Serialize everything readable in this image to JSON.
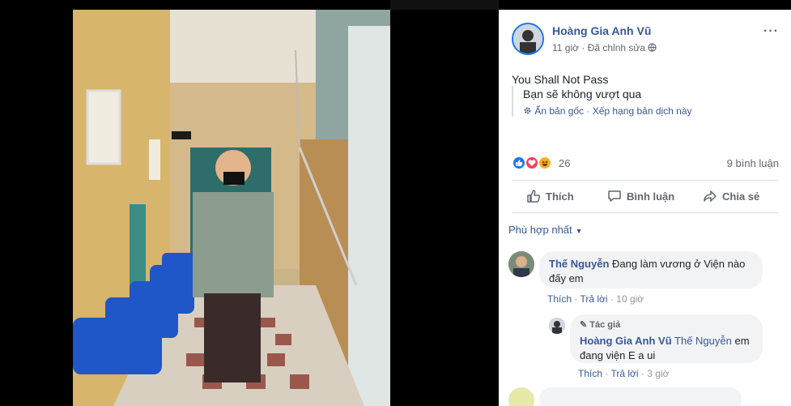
{
  "post": {
    "author": "Hoàng Gia Anh Vũ",
    "time": "11 giờ",
    "dot": "·",
    "edited": "Đã chỉnh sửa",
    "text": "You Shall Not Pass",
    "translation": "Bạn sẽ không vượt qua",
    "hide_original": "Ẩn bản gốc",
    "rate_translation": "Xếp hạng bản dịch này",
    "reaction_count": "26",
    "comment_count": "9 bình luận",
    "more": "···"
  },
  "actions": {
    "like": "Thích",
    "comment": "Bình luận",
    "share": "Chia sẻ"
  },
  "sort_label": "Phù hợp nhất",
  "comments": [
    {
      "name": "Thế Nguyễn",
      "text": "Đang làm vương ở Viện nào đấy em",
      "text_line1": "Đang làm vương ở Viện nào",
      "text_line2": "đấy em",
      "like": "Thích",
      "reply": "Trả lời",
      "time": "10 giờ"
    },
    {
      "badge": "Tác giả",
      "name": "Hoàng Gia Anh Vũ",
      "tag": "Thế Nguyễn",
      "text_line1_rest": "em",
      "text_line2": "đang viện E a ui",
      "like": "Thích",
      "reply": "Trả lời",
      "time": "3 giờ"
    }
  ],
  "colors": {
    "link": "#385898",
    "like_blue": "#1877f2",
    "love_red": "#f33e58",
    "haha_yellow": "#f7b125"
  }
}
